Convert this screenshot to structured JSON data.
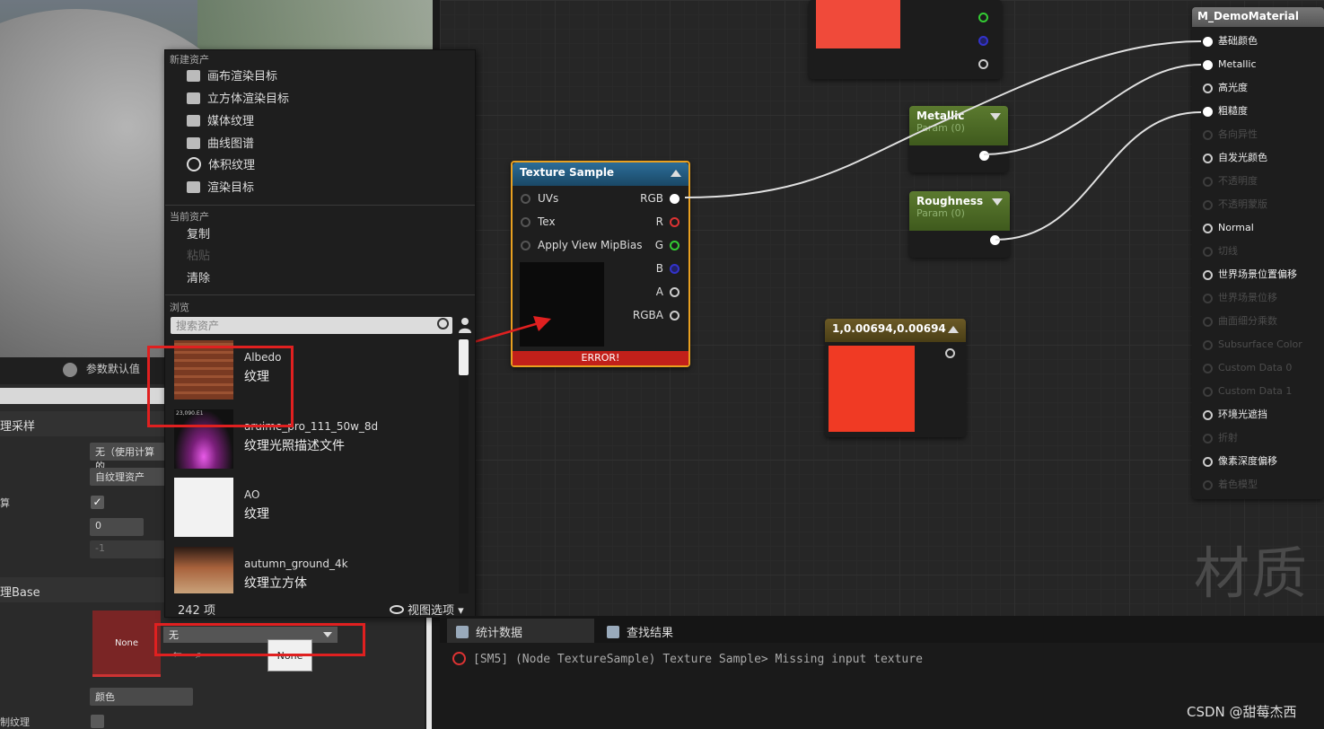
{
  "viewport": {},
  "details": {
    "param_defaults_tab": "参数默认值",
    "category_sampling": "理采样",
    "sampling_dropdown": "无（使用计算的",
    "source_dropdown": "自纹理资产",
    "row_checkbox_label": "算",
    "spin_value": "0",
    "spin_value2": "-1",
    "category_base": "理Base",
    "thumb_label": "None",
    "texture_combo": "无",
    "tooltip": "None",
    "channel_dropdown": "颜色",
    "last_row_label": "制纹理"
  },
  "menu": {
    "section_new": "新建资产",
    "new_items": [
      "画布渲染目标",
      "立方体渲染目标",
      "媒体纹理",
      "曲线图谱",
      "体积纹理",
      "渲染目标"
    ],
    "section_current": "当前资产",
    "current_items": [
      {
        "label": "复制",
        "enabled": true
      },
      {
        "label": "粘贴",
        "enabled": false
      },
      {
        "label": "清除",
        "enabled": true
      }
    ],
    "section_browse": "浏览",
    "search_placeholder": "搜索资产",
    "assets": [
      {
        "name": "Albedo",
        "type": "纹理"
      },
      {
        "name": "aruime_pro_111_50w_8d",
        "type": "纹理光照描述文件",
        "thumb_text": "23,090.E1"
      },
      {
        "name": "AO",
        "type": "纹理"
      },
      {
        "name": "autumn_ground_4k",
        "type": "纹理立方体"
      }
    ],
    "count": "242 项",
    "view_options": "视图选项"
  },
  "nodes": {
    "texture_sample": {
      "title": "Texture Sample",
      "inputs": [
        "UVs",
        "Tex",
        "Apply View MipBias"
      ],
      "outputs": [
        "RGB",
        "R",
        "G",
        "B",
        "A",
        "RGBA"
      ],
      "error": "ERROR!"
    },
    "metallic": {
      "title": "Metallic",
      "sub": "Param (0)"
    },
    "roughness": {
      "title": "Roughness",
      "sub": "Param (0)"
    },
    "constant": {
      "title": "1,0.00694,0.00694"
    },
    "material": {
      "title": "M_DemoMaterial",
      "pins": [
        {
          "label": "基础颜色",
          "active": true,
          "connected": true
        },
        {
          "label": "Metallic",
          "active": true,
          "connected": true
        },
        {
          "label": "高光度",
          "active": true,
          "connected": false
        },
        {
          "label": "粗糙度",
          "active": true,
          "connected": true
        },
        {
          "label": "各向异性",
          "active": false,
          "connected": false
        },
        {
          "label": "自发光颜色",
          "active": true,
          "connected": false
        },
        {
          "label": "不透明度",
          "active": false,
          "connected": false
        },
        {
          "label": "不透明蒙版",
          "active": false,
          "connected": false
        },
        {
          "label": "Normal",
          "active": true,
          "connected": false
        },
        {
          "label": "切线",
          "active": false,
          "connected": false
        },
        {
          "label": "世界场景位置偏移",
          "active": true,
          "connected": false
        },
        {
          "label": "世界场景位移",
          "active": false,
          "connected": false
        },
        {
          "label": "曲面细分乘数",
          "active": false,
          "connected": false
        },
        {
          "label": "Subsurface Color",
          "active": false,
          "connected": false
        },
        {
          "label": "Custom Data 0",
          "active": false,
          "connected": false
        },
        {
          "label": "Custom Data 1",
          "active": false,
          "connected": false
        },
        {
          "label": "环境光遮挡",
          "active": true,
          "connected": false
        },
        {
          "label": "折射",
          "active": false,
          "connected": false
        },
        {
          "label": "像素深度偏移",
          "active": true,
          "connected": false
        },
        {
          "label": "着色模型",
          "active": false,
          "connected": false
        }
      ]
    }
  },
  "graph": {
    "watermark": "材质"
  },
  "log": {
    "tabs": [
      "统计数据",
      "查找结果"
    ],
    "message": "[SM5] (Node TextureSample) Texture Sample> Missing input texture"
  },
  "credit": "CSDN @甜莓杰西",
  "colors": {
    "accent_red": "#e02020",
    "node_border": "#e8a020",
    "constant": "#f03a24"
  }
}
